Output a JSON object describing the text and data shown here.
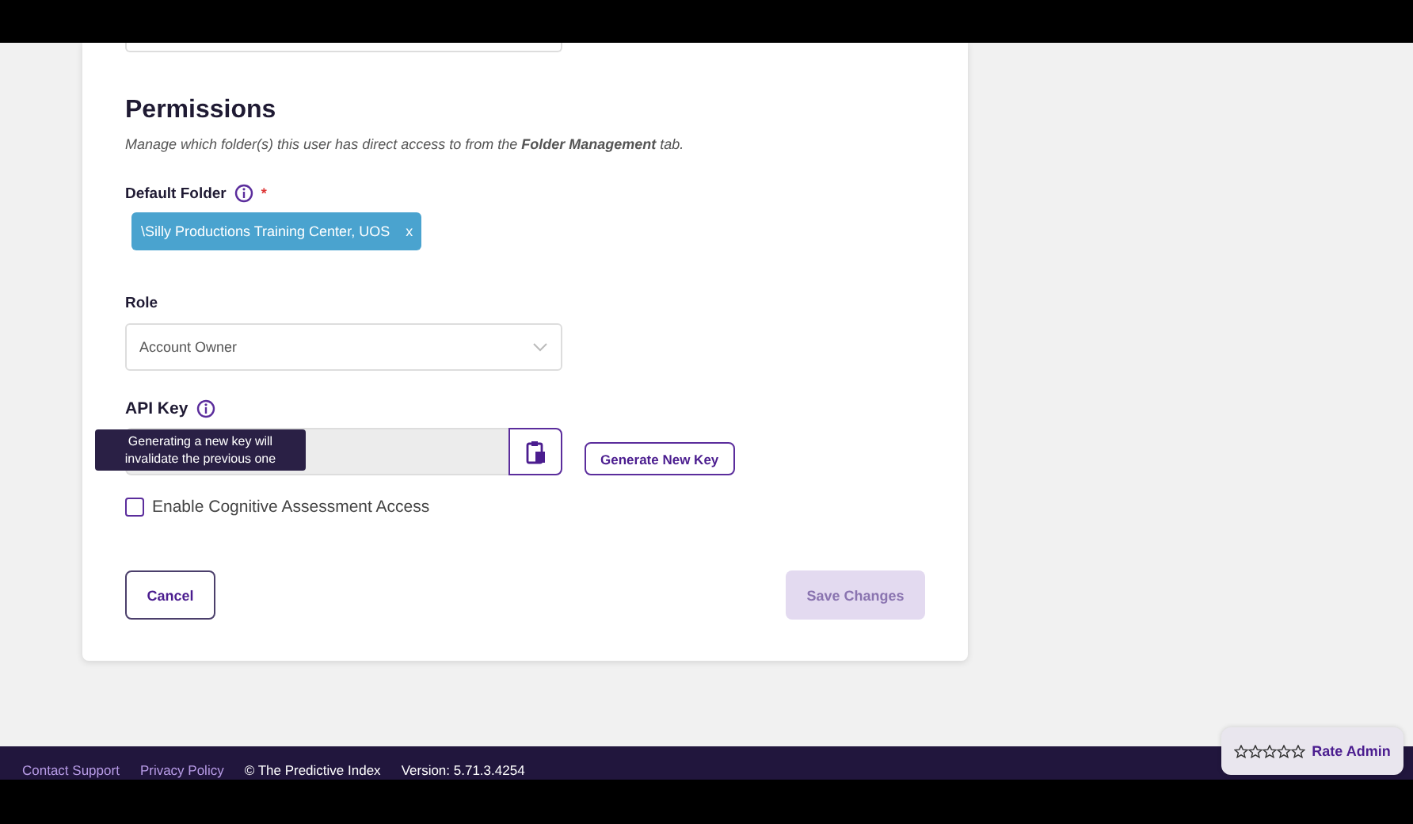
{
  "permissions": {
    "title": "Permissions",
    "description": "Manage which folder(s) this user has direct access to from the **Folder Management** tab.",
    "default_folder": {
      "label": "Default Folder",
      "required_mark": "*",
      "chips": [
        {
          "text": "\\Silly Productions Training Center, UOS",
          "remove": "x"
        }
      ]
    },
    "role": {
      "label": "Role",
      "value": "Account Owner"
    },
    "api_key": {
      "label": "API Key",
      "tooltip": "Generating a new key will invalidate the previous one",
      "generate_button": "Generate New Key"
    },
    "cognitive_access": {
      "label": "Enable Cognitive Assessment Access",
      "checked": false
    }
  },
  "actions": [
    {
      "label": "Cancel",
      "kind": "secondary",
      "disabled": false
    },
    {
      "label": "Save Changes",
      "kind": "primary",
      "disabled": true
    }
  ],
  "footer": {
    "links": [
      "Contact Support",
      "Privacy Policy"
    ],
    "copyright": "© The Predictive Index",
    "version": "Version: 5.71.3.4254"
  },
  "rate": {
    "label": "Rate Admin",
    "stars": 0
  }
}
